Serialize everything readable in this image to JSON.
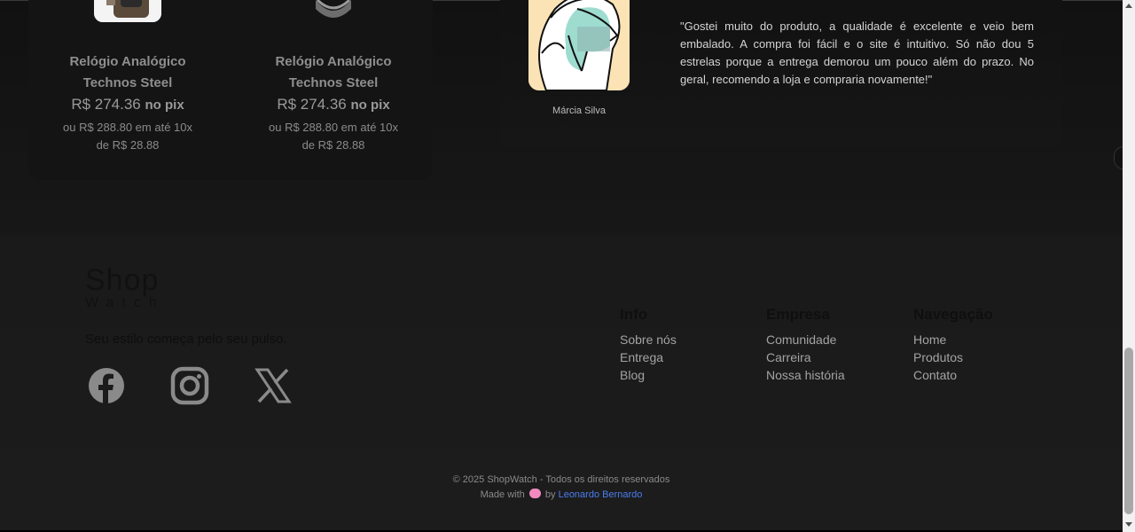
{
  "products": [
    {
      "name": "Relógio Analógico Technos Steel",
      "price": "R$ 274.36",
      "price_suffix": "no pix",
      "installments": "ou R$ 288.80 em até 10x de R$ 28.88"
    },
    {
      "name": "Relógio Analógico Technos Steel",
      "price": "R$ 274.36",
      "price_suffix": "no pix",
      "installments": "ou R$ 288.80 em até 10x de R$ 28.88"
    }
  ],
  "testimonial": {
    "name": "Márcia Silva",
    "quote": "\"Gostei muito do produto, a qualidade é excelente e veio bem embalado. A compra foi fácil e o site é intuitivo. Só não dou 5 estrelas porque a entrega demorou um pouco além do prazo. No geral, recomendo a loja e compraria novamente!\""
  },
  "footer": {
    "logo_top": "Shop",
    "logo_bottom": "Watch",
    "tagline": "Seu estilo começa pelo seu pulso.",
    "social_icons": [
      "facebook-icon",
      "instagram-icon",
      "x-icon"
    ],
    "columns": [
      {
        "title": "Info",
        "links": [
          "Sobre nós",
          "Entrega",
          "Blog"
        ]
      },
      {
        "title": "Empresa",
        "links": [
          "Comunidade",
          "Carreira",
          "Nossa história"
        ]
      },
      {
        "title": "Navegação",
        "links": [
          "Home",
          "Produtos",
          "Contato"
        ]
      }
    ],
    "copyright": "© 2025 ShopWatch - Todos os direitos reservados",
    "made_with": "Made with",
    "by": "by",
    "author": "Leonardo Bernardo"
  },
  "colors": {
    "background": "#1b1b1b",
    "card": "#141414",
    "author_link": "#4a7df0",
    "brain": "#f28ac0"
  }
}
